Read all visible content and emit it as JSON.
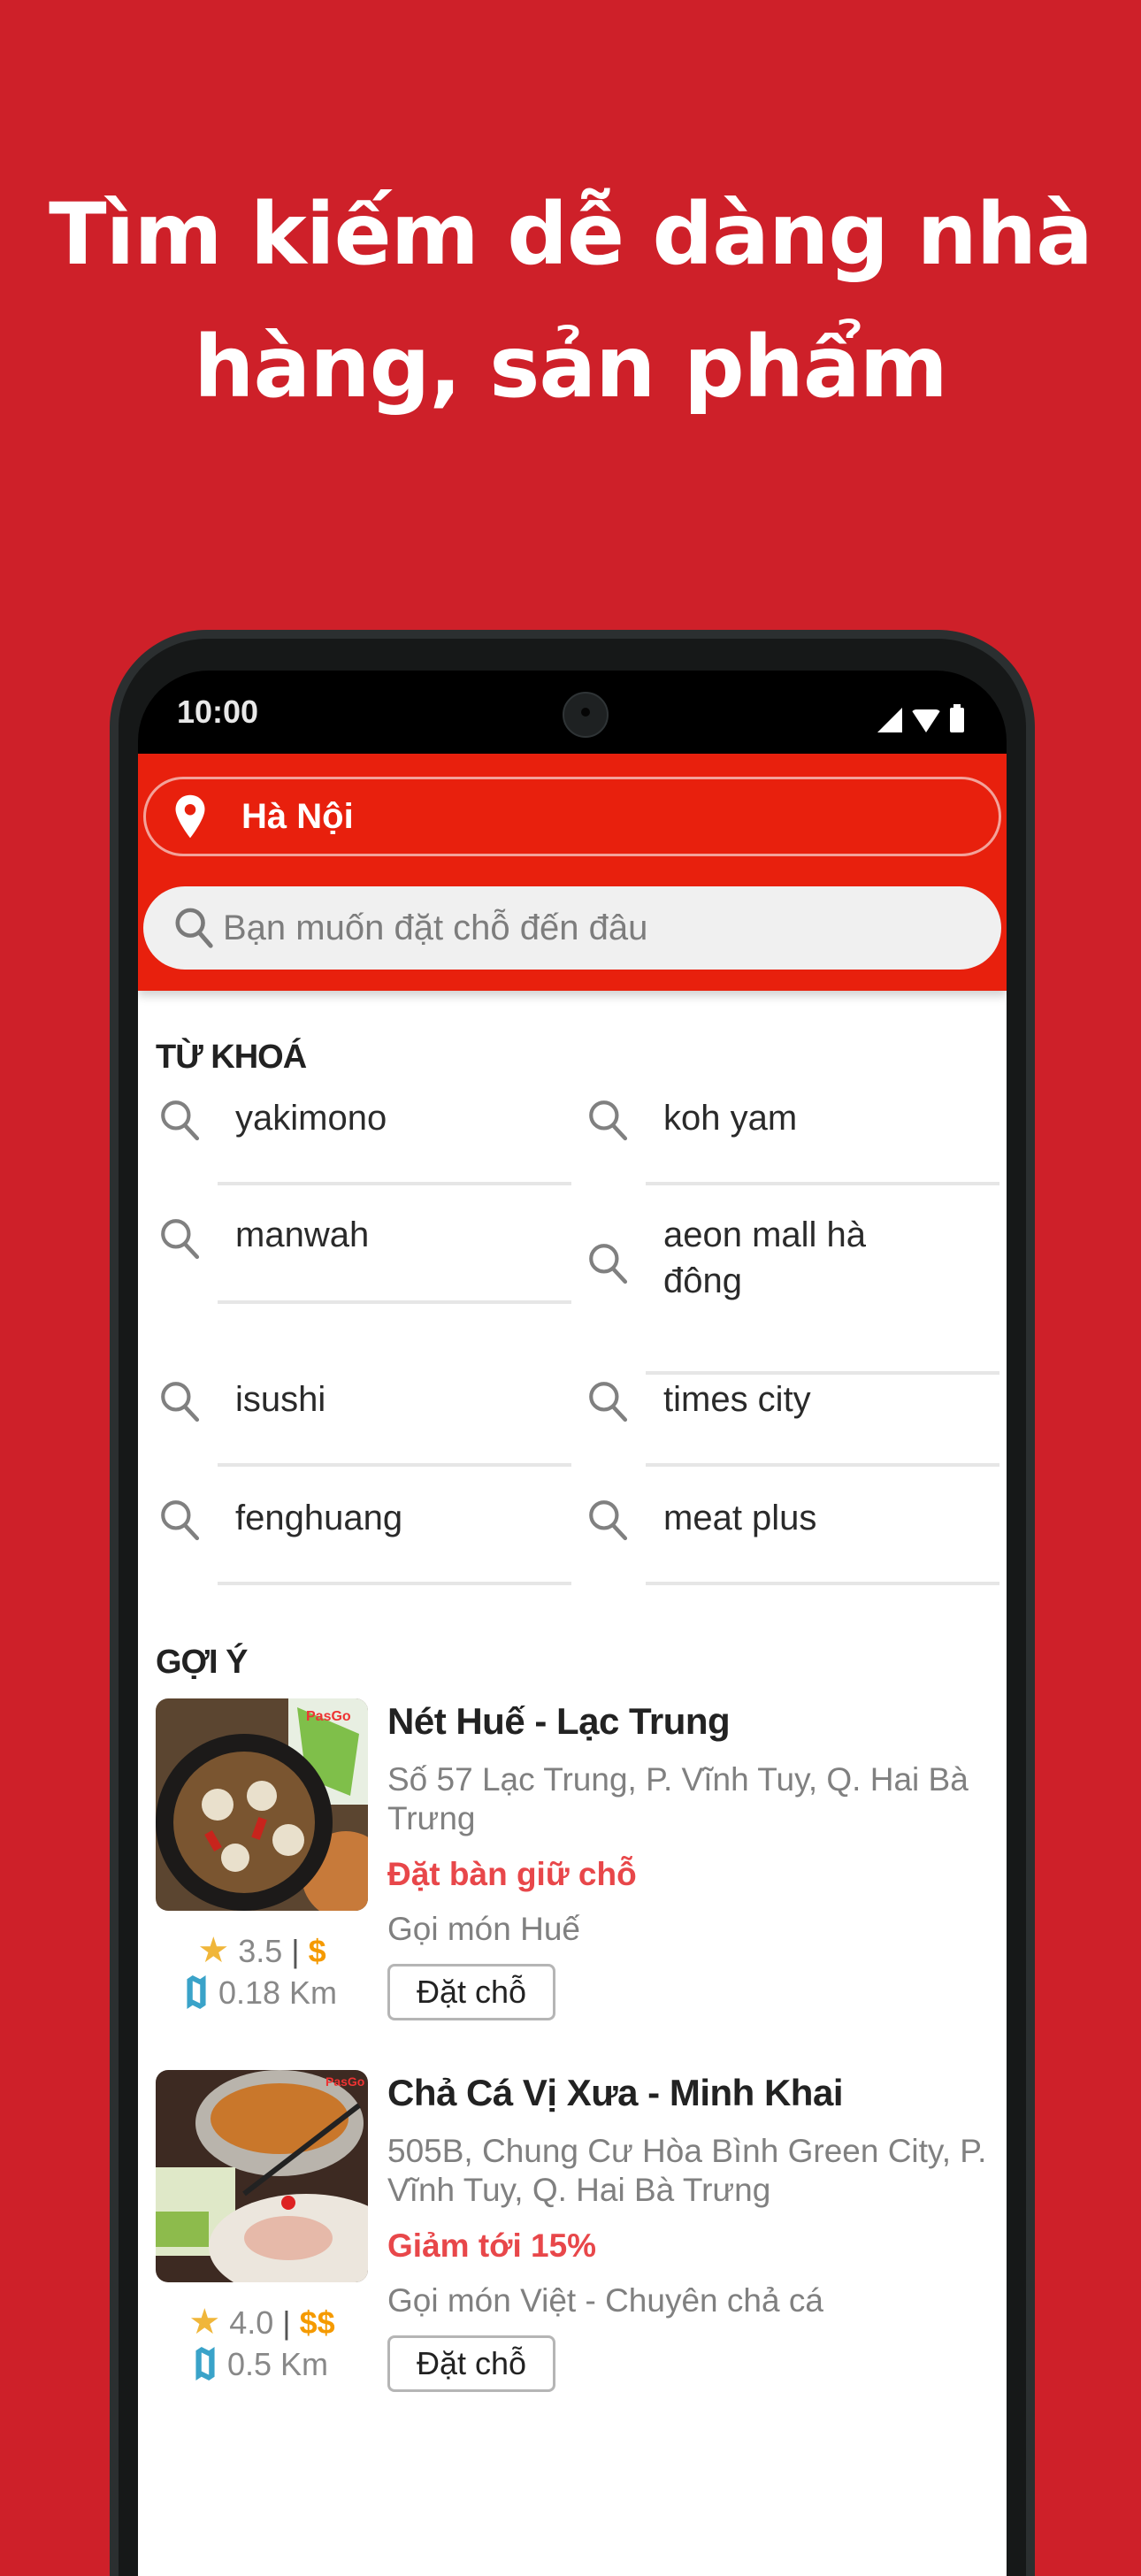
{
  "promo": {
    "headline_line1": "Tìm kiếm dễ dàng nhà",
    "headline_line2": "hàng, sản phẩm"
  },
  "status_bar": {
    "time": "10:00",
    "icons": [
      "signal-icon",
      "wifi-icon",
      "battery-icon"
    ]
  },
  "header": {
    "location_icon": "map-pin-icon",
    "location": "Hà Nội",
    "search_icon": "search-icon",
    "search_placeholder": "Bạn muốn đặt chỗ đến đâu",
    "search_value": ""
  },
  "keywords": {
    "title": "TỪ KHOÁ",
    "items": [
      {
        "label": "yakimono"
      },
      {
        "label": "koh yam"
      },
      {
        "label": "manwah"
      },
      {
        "label": "aeon mall hà đông"
      },
      {
        "label": "isushi"
      },
      {
        "label": "times city"
      },
      {
        "label": "fenghuang"
      },
      {
        "label": "meat plus"
      }
    ]
  },
  "suggestions": {
    "title": "GỢI Ý",
    "items": [
      {
        "name": "Nét Huế - Lạc Trung",
        "address": "Số 57 Lạc Trung, P. Vĩnh Tuy, Q. Hai Bà Trưng",
        "promo": "Đặt bàn giữ chỗ",
        "category": "Gọi món Huế",
        "rating": "3.5",
        "separator": "|",
        "price": "$",
        "distance": "0.18 Km",
        "button": "Đặt chỗ",
        "image_alt": "Nét Huế lotus root hotpot"
      },
      {
        "name": "Chả Cá Vị Xưa - Minh Khai",
        "address": "505B, Chung Cư Hòa Bình Green City, P. Vĩnh Tuy, Q. Hai Bà Trưng",
        "promo": "Giảm tới 15%",
        "category": "Gọi món Việt - Chuyên chả cá",
        "rating": "4.0",
        "separator": "|",
        "price": "$$",
        "distance": "0.5 Km",
        "button": "Đặt chỗ",
        "image_alt": "Chả cá hotpot with fish slices"
      }
    ]
  },
  "colors": {
    "background": "#CE2029",
    "header": "#E8200D",
    "promo_text": "#E8474A",
    "price": "#F59A00",
    "star": "#F0B63A",
    "map_icon": "#3AA3C9"
  }
}
